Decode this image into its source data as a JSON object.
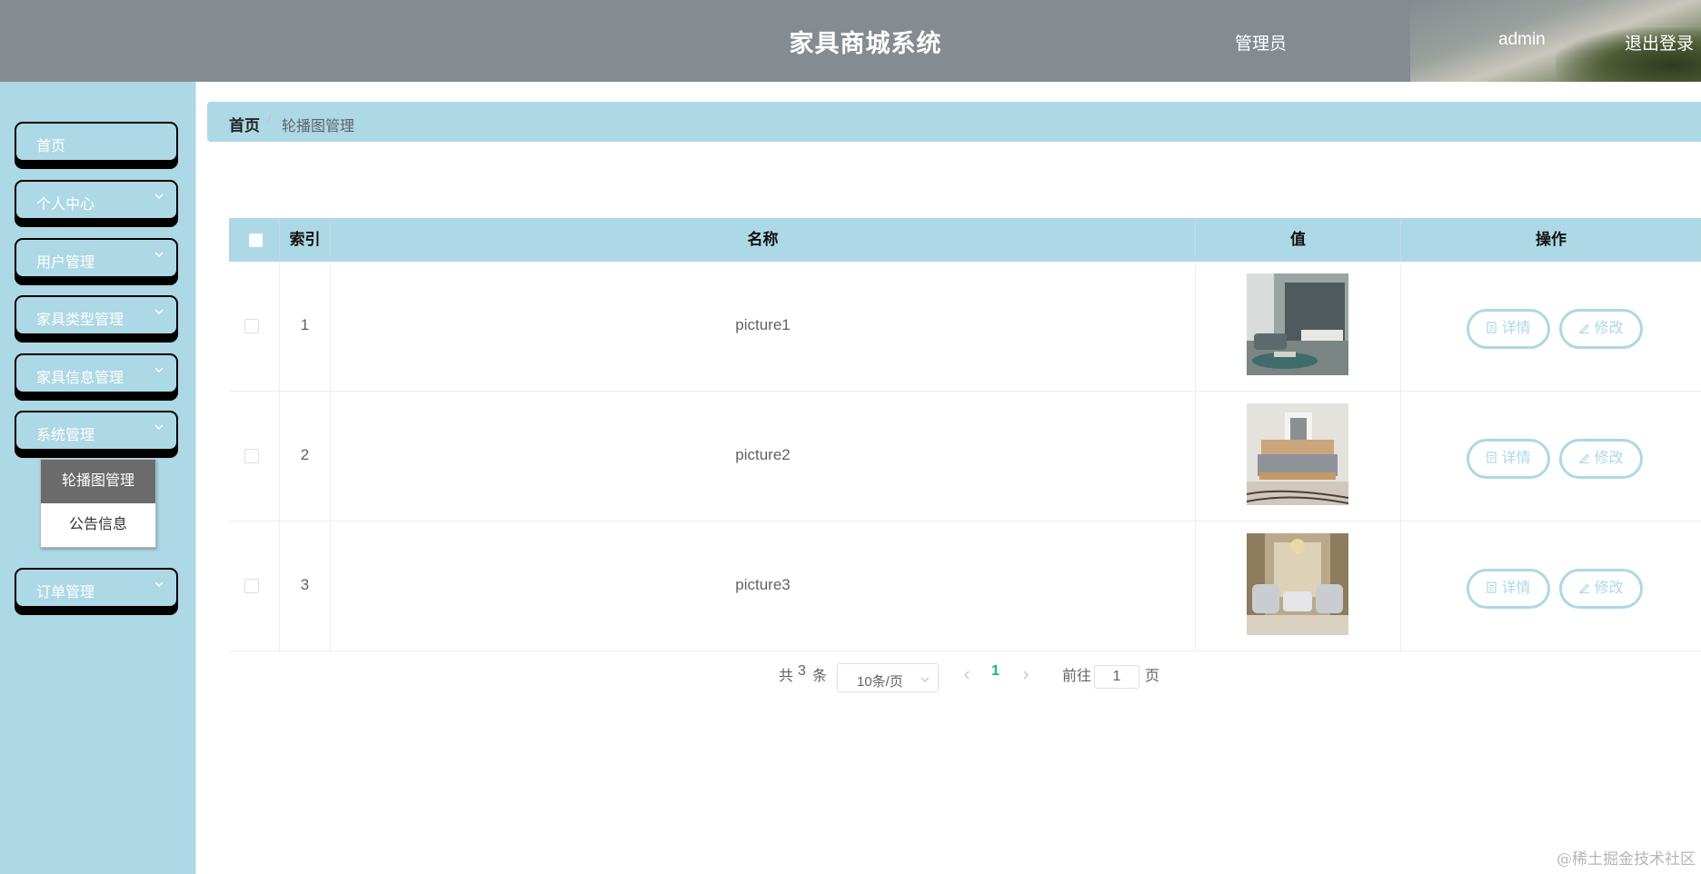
{
  "header": {
    "title": "家具商城系统",
    "user_role": "管理员",
    "username": "admin",
    "logout": "退出登录"
  },
  "sidebar": {
    "items": [
      {
        "label": "首页",
        "has_arrow": false
      },
      {
        "label": "个人中心",
        "has_arrow": true
      },
      {
        "label": "用户管理",
        "has_arrow": true
      },
      {
        "label": "家具类型管理",
        "has_arrow": true
      },
      {
        "label": "家具信息管理",
        "has_arrow": true
      },
      {
        "label": "系统管理",
        "has_arrow": true
      },
      {
        "label": "订单管理",
        "has_arrow": true
      }
    ],
    "submenu": [
      {
        "label": "轮播图管理",
        "active": true
      },
      {
        "label": "公告信息",
        "active": false
      }
    ]
  },
  "breadcrumb": {
    "home": "首页",
    "current": "轮播图管理"
  },
  "table": {
    "columns": [
      "索引",
      "名称",
      "值",
      "操作"
    ],
    "rows": [
      {
        "index": "1",
        "name": "picture1",
        "image": "living-room-image"
      },
      {
        "index": "2",
        "name": "picture2",
        "image": "bedroom-image"
      },
      {
        "index": "3",
        "name": "picture3",
        "image": "classic-lounge-image"
      }
    ],
    "actions": {
      "detail": "详情",
      "edit": "修改"
    }
  },
  "pagination": {
    "total_prefix": "共",
    "total": "3",
    "total_suffix": "条",
    "page_size": "10条/页",
    "current_page": "1",
    "goto_label": "前往",
    "goto_value": "1",
    "page_unit": "页"
  },
  "watermark": "@稀土掘金技术社区",
  "colors": {
    "header_bg": "#848c91",
    "sidebar_bg": "#add8e6",
    "active_page": "#13b887",
    "submenu_active": "#6b6b6b"
  }
}
